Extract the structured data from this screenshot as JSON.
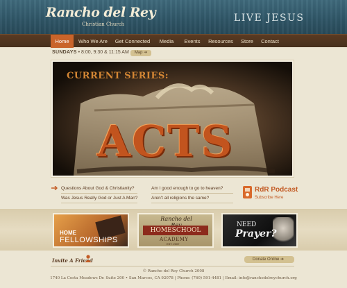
{
  "header": {
    "logo_main": "Rancho del Rey",
    "logo_sub": "Christian Church",
    "tagline": "LIVE JESUS"
  },
  "nav": {
    "items": [
      {
        "label": "Home",
        "active": true
      },
      {
        "label": "Who We Are"
      },
      {
        "label": "Get Connected"
      },
      {
        "label": "Media"
      },
      {
        "label": "Events"
      },
      {
        "label": "Resources"
      },
      {
        "label": "Store"
      },
      {
        "label": "Contact"
      }
    ]
  },
  "service": {
    "day": "SUNDAYS",
    "times": "8:00, 9:30 & 11:15 AM",
    "map_label": "Map"
  },
  "hero": {
    "series_label": "CURRENT SERIES:",
    "title": "ACTS"
  },
  "links": [
    "Questions About God & Christianity?",
    "Am I good enough to go to heaven?",
    "Was Jesus Really God or Just A Man?",
    "Aren't all religions the same?"
  ],
  "podcast": {
    "title": "RdR Podcast",
    "subtitle": "Subscribe Here"
  },
  "promos": {
    "fellowships": {
      "line1": "HOME",
      "line2": "FELLOWSHIPS"
    },
    "homeschool": {
      "logo": "Rancho del Rey",
      "ribbon": "HOMESCHOOL",
      "academy": "ACADEMY",
      "est": "EST. 2007"
    },
    "prayer": {
      "line1": "NEED",
      "line2": "Prayer?"
    }
  },
  "invite": {
    "label": "Invite A Friend"
  },
  "donate": {
    "label": "Donate Online"
  },
  "footer": {
    "copyright": "© Rancho del Rey Church 2008",
    "address": "1740 La Costa Meadows Dr. Suite 200 • San Marcos, CA 92078  |  Phone: (760) 591-4481  |  Email: info@ranchodelreychurch.org"
  },
  "colors": {
    "accent": "#c9642a",
    "nav_bg": "#46301c",
    "header_bg": "#2f5566",
    "page_bg": "#ece6d4"
  }
}
